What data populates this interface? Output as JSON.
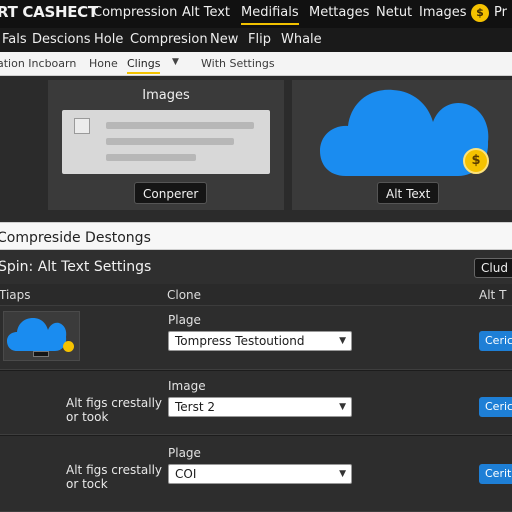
{
  "top_nav": {
    "brand": "RT CASHECT",
    "items": [
      {
        "label": "Compression",
        "active": false
      },
      {
        "label": "Alt Text",
        "active": false
      },
      {
        "label": "Medifials",
        "active": true
      },
      {
        "label": "Mettages",
        "active": false
      },
      {
        "label": "Netut",
        "active": false
      },
      {
        "label": "Images",
        "active": false
      }
    ],
    "coin_symbol": "$",
    "trailing_text": "Pr"
  },
  "menu": {
    "items": [
      "Fals",
      "Descions",
      "Hole",
      "Compresion",
      "New",
      "Flip",
      "Whale"
    ]
  },
  "tabs": {
    "items": [
      "ation Incboarn",
      "Hone",
      "Clings",
      "With Settings"
    ],
    "active_index": 2
  },
  "preview": {
    "left_card": {
      "title": "Images",
      "button": "Conperer"
    },
    "right_card": {
      "button": "Alt Text",
      "coin_symbol": "$"
    }
  },
  "section": {
    "title": "Compreside Destongs"
  },
  "settings": {
    "title": "Spin: Alt Text Settings",
    "cloud_button": "Clud",
    "columns": [
      "Tiaps",
      "Clone",
      "Alt T"
    ]
  },
  "rows": [
    {
      "field_label": "Plage",
      "left_label": "",
      "select_value": "Tompress Testoutiond",
      "button": "Ceric"
    },
    {
      "field_label": "Image",
      "left_label": "Alt figs crestally or took",
      "select_value": "Terst 2",
      "button": "Ceric"
    },
    {
      "field_label": "Plage",
      "left_label": "Alt figs crestally or tock",
      "select_value": "COI",
      "button": "Cerit"
    }
  ],
  "colors": {
    "accent": "#f2c200",
    "primary_button": "#1e7fd6",
    "cloud": "#1a8cf0"
  }
}
